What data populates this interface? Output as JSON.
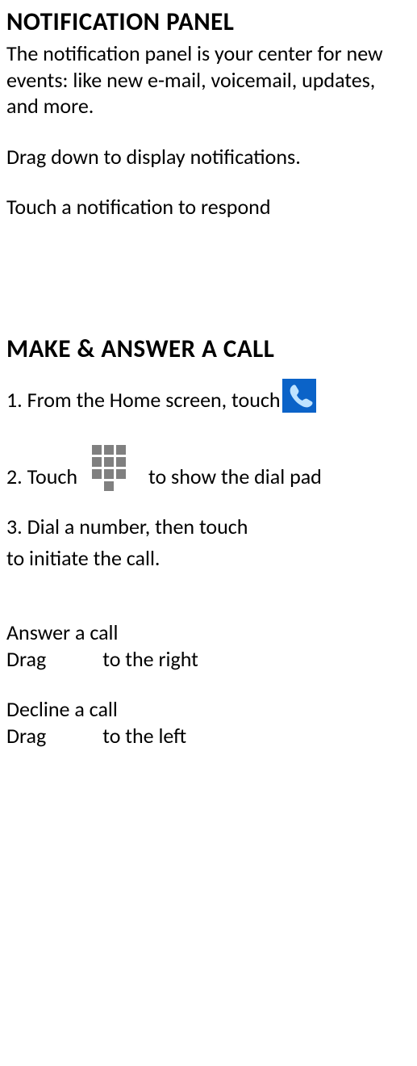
{
  "section1": {
    "heading": "NOTIFICATION PANEL",
    "para1": "The notification panel is your center for new events: like new e-mail, voicemail, updates, and more.",
    "para2": "Drag down to display notifications.",
    "para3": "Touch a notification to respond"
  },
  "section2": {
    "heading": "MAKE & ANSWER A CALL",
    "step1_prefix": "1. From the Home screen, touch",
    "step2_before": "2. Touch",
    "step2_after": "to show the dial pad",
    "step3_line1": "3. Dial a number, then touch",
    "step3_line2": "to initiate the call.",
    "answer_heading": "Answer a call",
    "answer_drag": "Drag",
    "answer_dir": "to the right",
    "decline_heading": "Decline a call",
    "decline_drag": "Drag",
    "decline_dir": "to the left"
  }
}
